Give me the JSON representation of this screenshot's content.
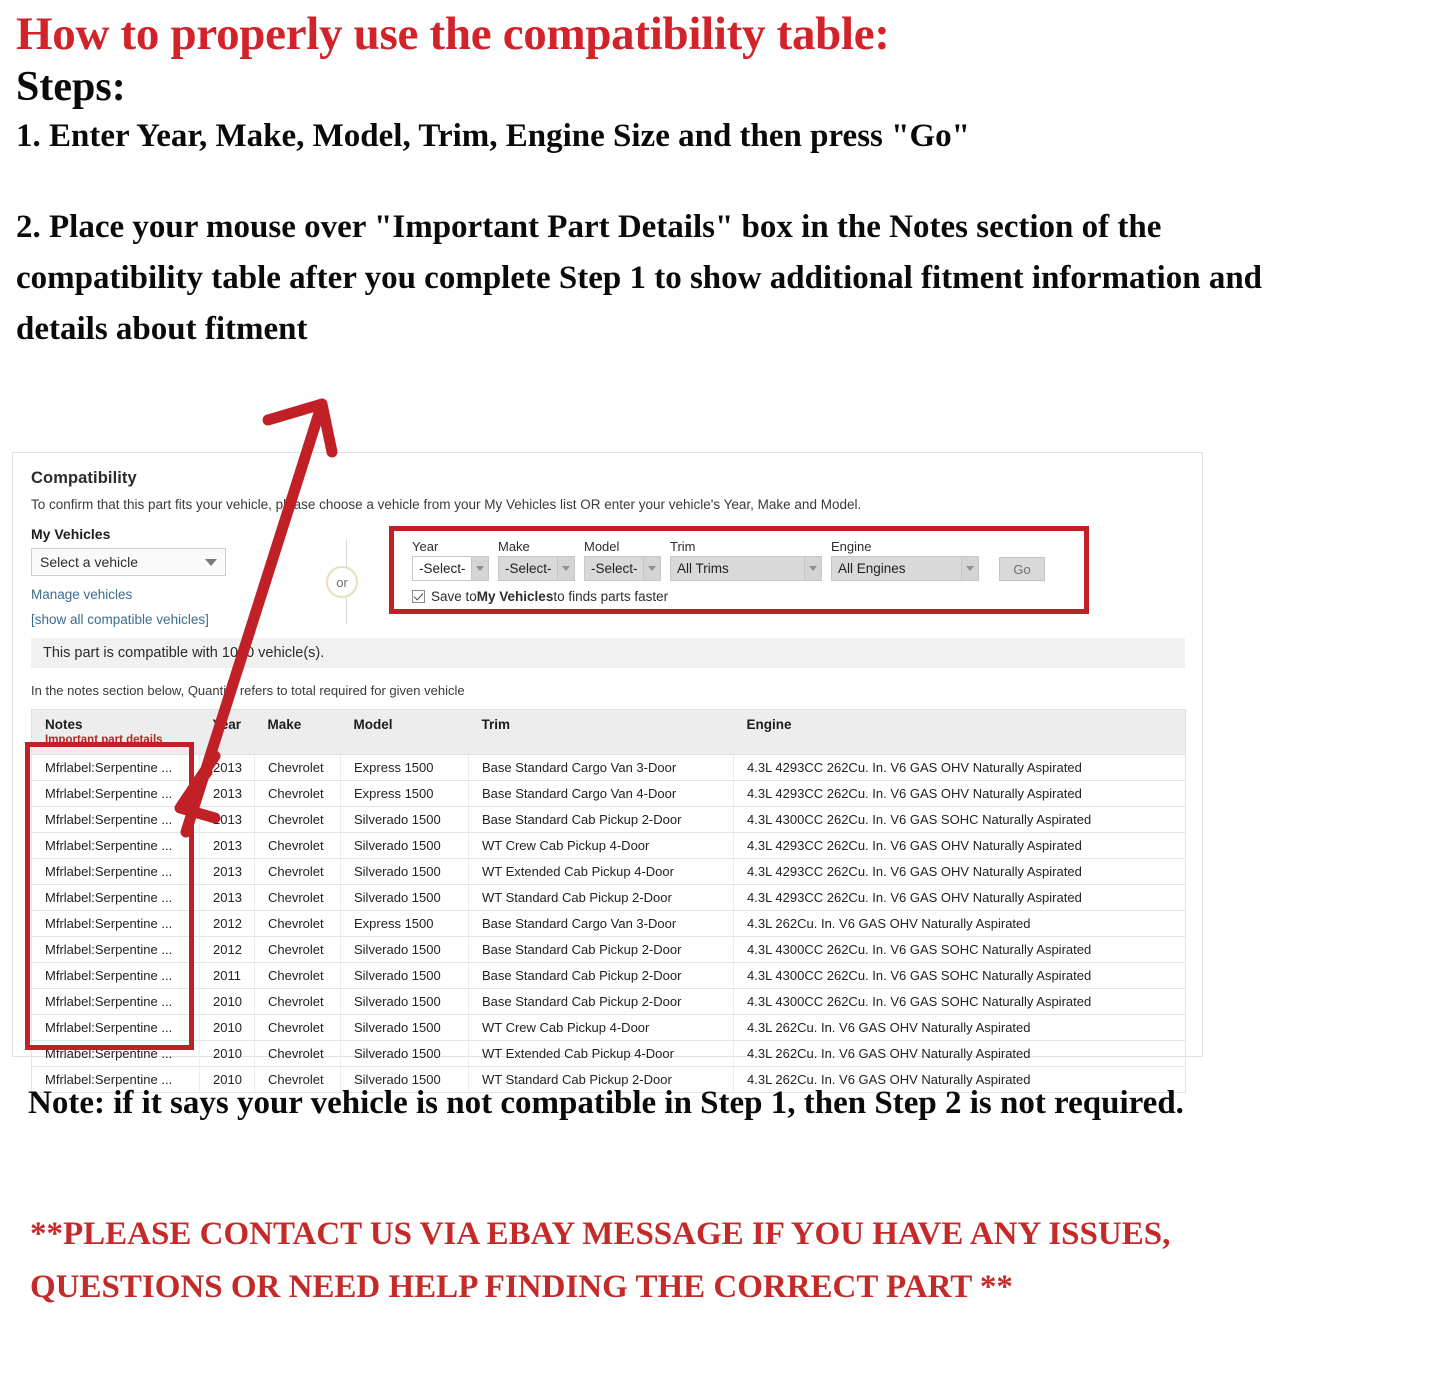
{
  "headings": {
    "title": "How to properly use the compatibility table:",
    "steps_label": "Steps:",
    "step1": "1. Enter Year, Make, Model, Trim, Engine Size and then press \"Go\"",
    "step2": "2. Place your mouse over \"Important Part Details\" box in the Notes section of the compatibility table after you complete Step 1 to show additional fitment information and details about fitment"
  },
  "footer": {
    "note": "Note: if it says your vehicle is not compatible in Step 1, then Step 2 is not required.",
    "contact": "**PLEASE CONTACT US VIA EBAY MESSAGE IF YOU HAVE ANY ISSUES, QUESTIONS OR NEED HELP FINDING THE CORRECT PART **"
  },
  "compatibility": {
    "title": "Compatibility",
    "subtitle": "To confirm that this part fits your vehicle, please choose a vehicle from your My Vehicles list OR enter your vehicle's Year, Make and Model.",
    "my_vehicles_label": "My Vehicles",
    "my_vehicles_value": "Select a vehicle",
    "manage_vehicles_link": "Manage vehicles",
    "show_all_link": "[show all compatible vehicles]",
    "or_text": "or",
    "banner": "This part is compatible with 1000 vehicle(s).",
    "notes_hint": "In the notes section below, Quantity refers to total required for given vehicle",
    "form": {
      "year_label": "Year",
      "year_value": "-Select-",
      "make_label": "Make",
      "make_value": "-Select-",
      "model_label": "Model",
      "model_value": "-Select-",
      "trim_label": "Trim",
      "trim_value": "All Trims",
      "engine_label": "Engine",
      "engine_value": "All Engines",
      "go_label": "Go",
      "save_prefix": "Save to ",
      "save_bold": "My Vehicles",
      "save_suffix": " to finds parts faster"
    },
    "table": {
      "headers": {
        "notes": "Notes",
        "notes_sub": "Important part details",
        "year": "Year",
        "make": "Make",
        "model": "Model",
        "trim": "Trim",
        "engine": "Engine"
      },
      "rows": [
        {
          "notes": "Mfrlabel:Serpentine ...",
          "year": "2013",
          "make": "Chevrolet",
          "model": "Express 1500",
          "trim": "Base Standard Cargo Van 3-Door",
          "engine": "4.3L 4293CC 262Cu. In. V6 GAS OHV Naturally Aspirated"
        },
        {
          "notes": "Mfrlabel:Serpentine ...",
          "year": "2013",
          "make": "Chevrolet",
          "model": "Express 1500",
          "trim": "Base Standard Cargo Van 4-Door",
          "engine": "4.3L 4293CC 262Cu. In. V6 GAS OHV Naturally Aspirated"
        },
        {
          "notes": "Mfrlabel:Serpentine ...",
          "year": "2013",
          "make": "Chevrolet",
          "model": "Silverado 1500",
          "trim": "Base Standard Cab Pickup 2-Door",
          "engine": "4.3L 4300CC 262Cu. In. V6 GAS SOHC Naturally Aspirated"
        },
        {
          "notes": "Mfrlabel:Serpentine ...",
          "year": "2013",
          "make": "Chevrolet",
          "model": "Silverado 1500",
          "trim": "WT Crew Cab Pickup 4-Door",
          "engine": "4.3L 4293CC 262Cu. In. V6 GAS OHV Naturally Aspirated"
        },
        {
          "notes": "Mfrlabel:Serpentine ...",
          "year": "2013",
          "make": "Chevrolet",
          "model": "Silverado 1500",
          "trim": "WT Extended Cab Pickup 4-Door",
          "engine": "4.3L 4293CC 262Cu. In. V6 GAS OHV Naturally Aspirated"
        },
        {
          "notes": "Mfrlabel:Serpentine ...",
          "year": "2013",
          "make": "Chevrolet",
          "model": "Silverado 1500",
          "trim": "WT Standard Cab Pickup 2-Door",
          "engine": "4.3L 4293CC 262Cu. In. V6 GAS OHV Naturally Aspirated"
        },
        {
          "notes": "Mfrlabel:Serpentine ...",
          "year": "2012",
          "make": "Chevrolet",
          "model": "Express 1500",
          "trim": "Base Standard Cargo Van 3-Door",
          "engine": "4.3L 262Cu. In. V6 GAS OHV Naturally Aspirated"
        },
        {
          "notes": "Mfrlabel:Serpentine ...",
          "year": "2012",
          "make": "Chevrolet",
          "model": "Silverado 1500",
          "trim": "Base Standard Cab Pickup 2-Door",
          "engine": "4.3L 4300CC 262Cu. In. V6 GAS SOHC Naturally Aspirated"
        },
        {
          "notes": "Mfrlabel:Serpentine ...",
          "year": "2011",
          "make": "Chevrolet",
          "model": "Silverado 1500",
          "trim": "Base Standard Cab Pickup 2-Door",
          "engine": "4.3L 4300CC 262Cu. In. V6 GAS SOHC Naturally Aspirated"
        },
        {
          "notes": "Mfrlabel:Serpentine ...",
          "year": "2010",
          "make": "Chevrolet",
          "model": "Silverado 1500",
          "trim": "Base Standard Cab Pickup 2-Door",
          "engine": "4.3L 4300CC 262Cu. In. V6 GAS SOHC Naturally Aspirated"
        },
        {
          "notes": "Mfrlabel:Serpentine ...",
          "year": "2010",
          "make": "Chevrolet",
          "model": "Silverado 1500",
          "trim": "WT Crew Cab Pickup 4-Door",
          "engine": "4.3L 262Cu. In. V6 GAS OHV Naturally Aspirated"
        },
        {
          "notes": "Mfrlabel:Serpentine ...",
          "year": "2010",
          "make": "Chevrolet",
          "model": "Silverado 1500",
          "trim": "WT Extended Cab Pickup 4-Door",
          "engine": "4.3L 262Cu. In. V6 GAS OHV Naturally Aspirated"
        },
        {
          "notes": "Mfrlabel:Serpentine ...",
          "year": "2010",
          "make": "Chevrolet",
          "model": "Silverado 1500",
          "trim": "WT Standard Cab Pickup 2-Door",
          "engine": "4.3L 262Cu. In. V6 GAS OHV Naturally Aspirated"
        }
      ]
    }
  },
  "colors": {
    "red_heading": "#d2232a",
    "red_highlight": "#c02026",
    "link_blue": "#3d6d8e",
    "banner_grey": "#f1f1f1"
  }
}
